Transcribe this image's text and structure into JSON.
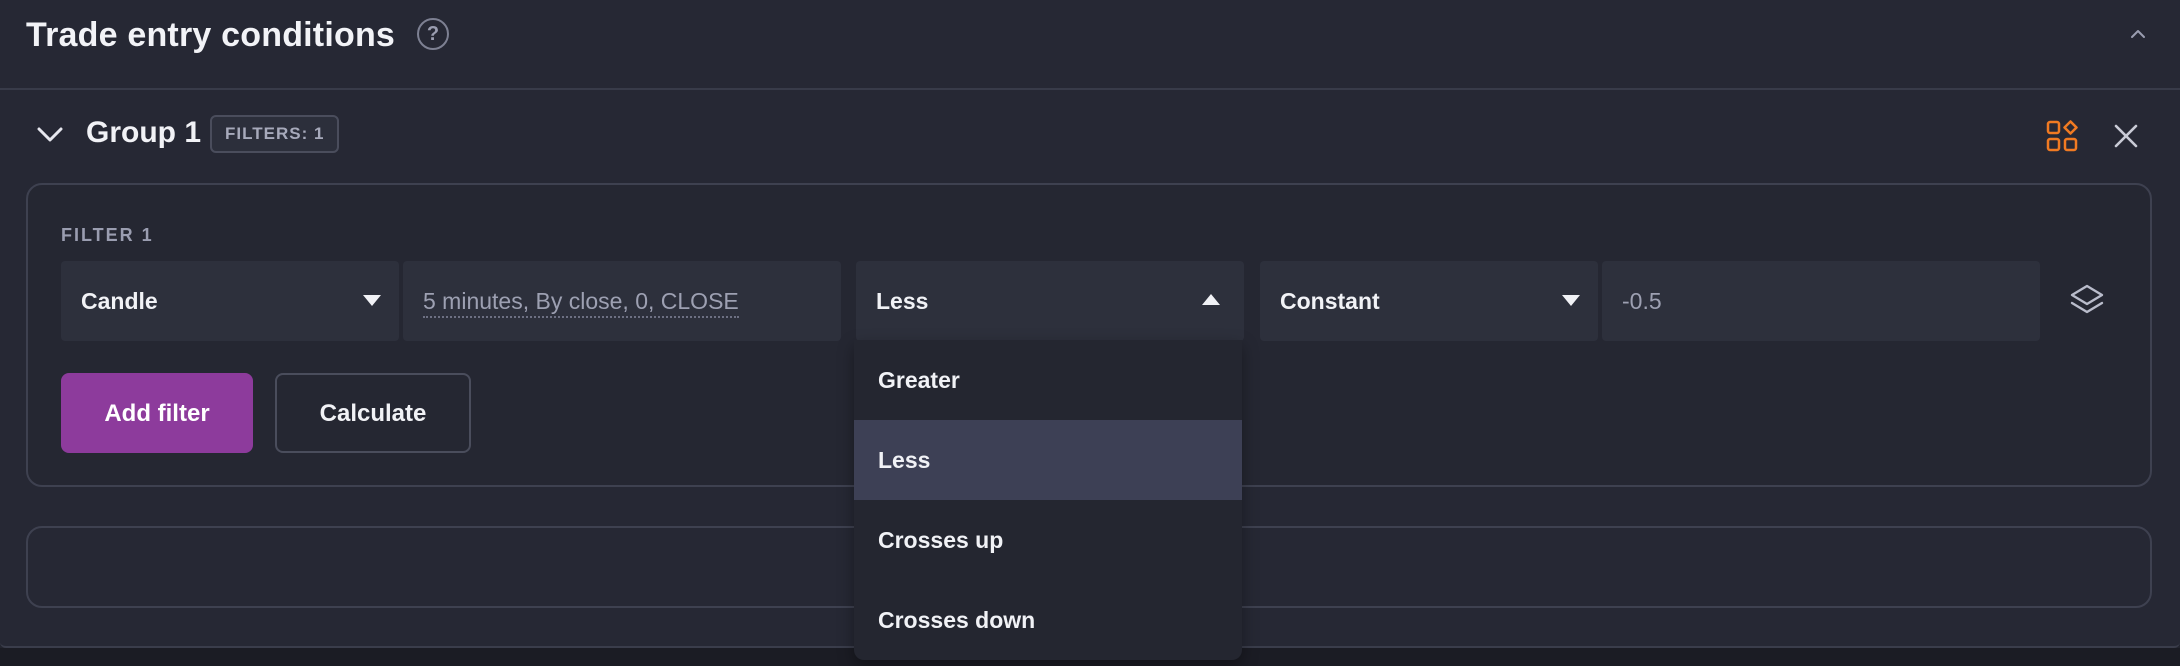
{
  "header": {
    "title": "Trade entry conditions",
    "help_symbol": "?"
  },
  "group": {
    "title": "Group 1",
    "filters_badge": "FILTERS: 1"
  },
  "filter": {
    "label": "FILTER 1",
    "source_select": "Candle",
    "source_params": "5 minutes, By close, 0, CLOSE",
    "operator_select": "Less",
    "target_select": "Constant",
    "target_value": "-0.5"
  },
  "buttons": {
    "add_filter": "Add filter",
    "calculate": "Calculate"
  },
  "operator_menu": {
    "options": [
      "Greater",
      "Less",
      "Crosses up",
      "Crosses down"
    ],
    "selected": "Less"
  },
  "colors": {
    "accent_purple": "#8d3b9c",
    "accent_orange": "#f07a22",
    "selected_row": "#3d4055"
  },
  "icons": [
    "help-icon",
    "chevron-up-icon",
    "chevron-down-icon",
    "grid-icon",
    "close-icon",
    "caret-down-icon",
    "caret-up-icon",
    "layers-icon"
  ]
}
